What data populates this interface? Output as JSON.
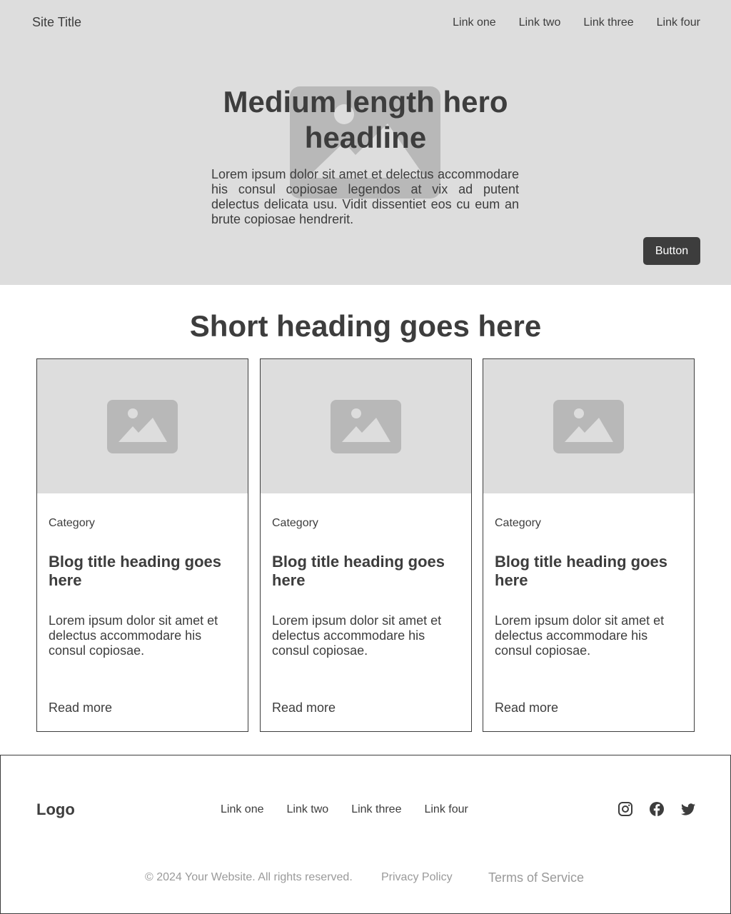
{
  "header": {
    "site_title": "Site Title",
    "nav": [
      "Link one",
      "Link two",
      "Link three",
      "Link four"
    ]
  },
  "hero": {
    "headline": "Medium length hero headline",
    "body": "Lorem ipsum dolor sit amet et delectus accommodare his consul copiosae legendos at vix ad putent delectus delicata usu. Vidit dissentiet eos cu eum an brute copiosae hendrerit.",
    "button_label": "Button",
    "background_icon": "image-placeholder-icon"
  },
  "blog": {
    "heading": "Short heading goes here",
    "cards": [
      {
        "image_icon": "image-placeholder-icon",
        "category": "Category",
        "title": "Blog title heading goes here",
        "excerpt": "Lorem ipsum dolor sit amet et delectus accommodare his consul copiosae.",
        "read_more": "Read more"
      },
      {
        "image_icon": "image-placeholder-icon",
        "category": "Category",
        "title": "Blog title heading goes here",
        "excerpt": "Lorem ipsum dolor sit amet et delectus accommodare his consul copiosae.",
        "read_more": "Read more"
      },
      {
        "image_icon": "image-placeholder-icon",
        "category": "Category",
        "title": "Blog title heading goes here",
        "excerpt": "Lorem ipsum dolor sit amet et delectus accommodare his consul copiosae.",
        "read_more": "Read more"
      }
    ]
  },
  "footer": {
    "logo": "Logo",
    "nav": [
      "Link one",
      "Link two",
      "Link three",
      "Link four"
    ],
    "social": [
      "instagram-icon",
      "facebook-icon",
      "twitter-icon"
    ],
    "copyright": "© 2024 Your Website. All rights reserved.",
    "privacy": "Privacy Policy",
    "terms": "Terms of Service"
  },
  "colors": {
    "text": "#3d3d3d",
    "hero_bg": "#dddddd",
    "placeholder_icon": "#b8b8b8",
    "muted": "#9a9a9a",
    "button_bg": "#3d3d3d",
    "button_text": "#ffffff"
  }
}
